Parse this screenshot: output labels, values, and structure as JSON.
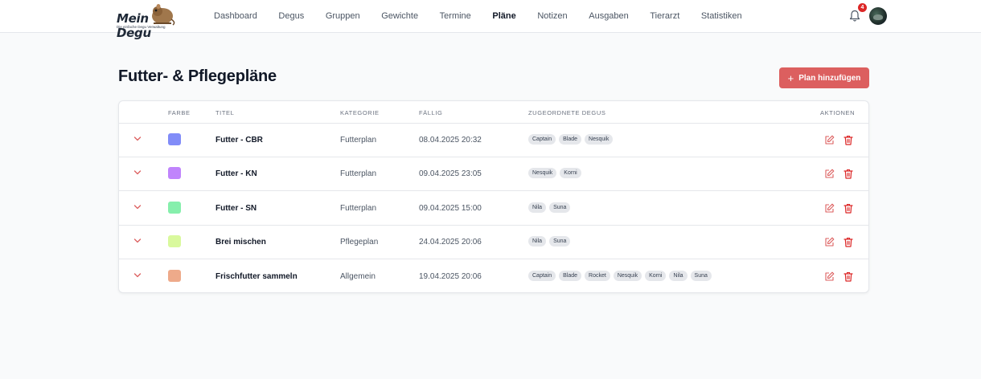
{
  "brand": {
    "name": "Mein Degu",
    "tagline": "Die einfache Degu Verwaltung"
  },
  "nav": {
    "items": [
      {
        "label": "Dashboard",
        "active": false
      },
      {
        "label": "Degus",
        "active": false
      },
      {
        "label": "Gruppen",
        "active": false
      },
      {
        "label": "Gewichte",
        "active": false
      },
      {
        "label": "Termine",
        "active": false
      },
      {
        "label": "Pläne",
        "active": true
      },
      {
        "label": "Notizen",
        "active": false
      },
      {
        "label": "Ausgaben",
        "active": false
      },
      {
        "label": "Tierarzt",
        "active": false
      },
      {
        "label": "Statistiken",
        "active": false
      }
    ],
    "notification_count": "4",
    "bell_icon": "bell-icon",
    "avatar_icon": "user-avatar"
  },
  "page": {
    "title": "Futter- & Pflegepläne",
    "add_button_icon": "+",
    "add_button_label": "Plan hinzufügen"
  },
  "table": {
    "headers": {
      "color": "Farbe",
      "title": "Titel",
      "category": "Kategorie",
      "due": "Fällig",
      "degus": "Zugeordnete Degus",
      "actions": "Aktionen"
    },
    "rows": [
      {
        "color": "#818cf8",
        "title": "Futter - CBR",
        "category": "Futterplan",
        "due": "08.04.2025 20:32",
        "degus": [
          "Captain",
          "Blade",
          "Nesquik"
        ]
      },
      {
        "color": "#c084fc",
        "title": "Futter - KN",
        "category": "Futterplan",
        "due": "09.04.2025 23:05",
        "degus": [
          "Nesquik",
          "Korni"
        ]
      },
      {
        "color": "#86efac",
        "title": "Futter - SN",
        "category": "Futterplan",
        "due": "09.04.2025 15:00",
        "degus": [
          "Nila",
          "Suna"
        ]
      },
      {
        "color": "#d9f99d",
        "title": "Brei mischen",
        "category": "Pflegeplan",
        "due": "24.04.2025 20:06",
        "degus": [
          "Nila",
          "Suna"
        ]
      },
      {
        "color": "#eeaa8a",
        "title": "Frischfutter sammeln",
        "category": "Allgemein",
        "due": "19.04.2025 20:06",
        "degus": [
          "Captain",
          "Blade",
          "Rocket",
          "Nesquik",
          "Korni",
          "Nila",
          "Suna"
        ]
      }
    ]
  },
  "colors": {
    "accent": "#dc5f5f",
    "danger": "#dc2626"
  }
}
